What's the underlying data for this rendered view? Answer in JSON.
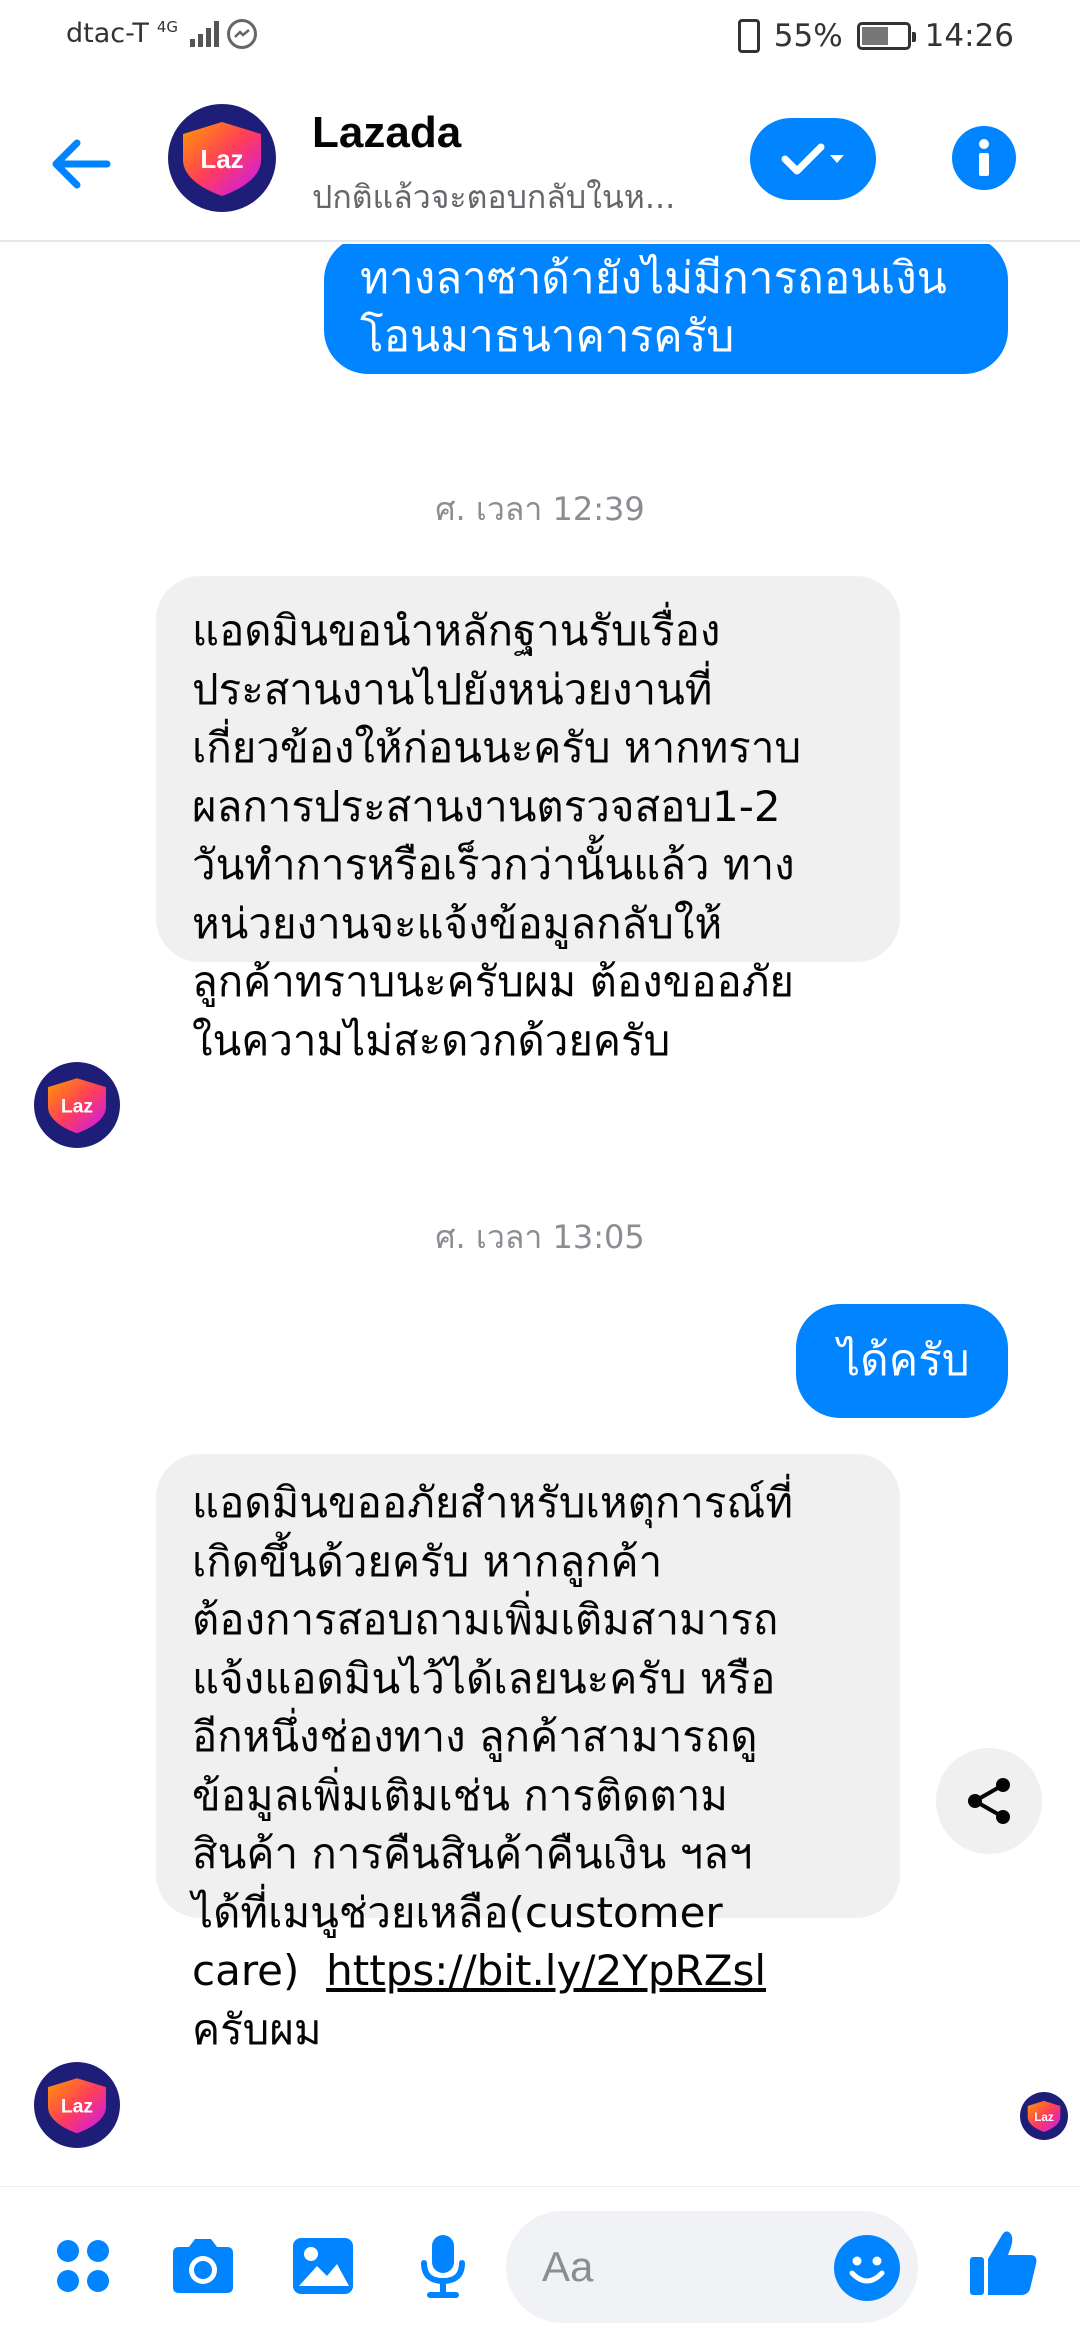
{
  "status": {
    "carrier": "dtac-T",
    "network": "4G",
    "battery": "55%",
    "time": "14:26"
  },
  "header": {
    "name": "Lazada",
    "subtitle": "ปกติแล้วจะตอบกลับในห...",
    "avatar_text": "Laz"
  },
  "messages": {
    "out1_line1": "ทางลาซาด้ายังไม่มีการถอนเงิน",
    "out1_line2": "โอนมาธนาคารครับ",
    "ts1": "ศ. เวลา 12:39",
    "in1_lines": [
      "แอดมินขอนำหลักฐานรับเรื่อง",
      "ประสานงานไปยังหน่วยงานที่",
      "เกี่ยวข้องให้ก่อนนะครับ หากทราบ",
      "ผลการประสานงานตรวจสอบ1-2",
      "วันทำการหรือเร็วกว่านั้นแล้ว ทาง",
      "หน่วยงานจะแจ้งข้อมูลกลับให้",
      "ลูกค้าทราบนะครับผม ต้องขออภัย",
      "ในความไม่สะดวกด้วยครับ"
    ],
    "ts2": "ศ. เวลา 13:05",
    "out2": "ได้ครับ",
    "in2_lines": [
      "แอดมินขออภัยสำหรับเหตุการณ์ที่",
      "เกิดขึ้นด้วยครับ หากลูกค้า",
      "ต้องการสอบถามเพิ่มเติมสามารถ",
      "แจ้งแอดมินไว้ได้เลยนะครับ หรือ",
      "อีกหนึ่งช่องทาง ลูกค้าสามารถดู",
      "ข้อมูลเพิ่มเติมเช่น การติดตาม",
      "สินค้า การคืนสินค้าคืนเงิน ฯลฯ",
      "ได้ที่เมนูช่วยเหลือ(customer"
    ],
    "in2_care": "care)",
    "in2_link": "https://bit.ly/2YpRZsl",
    "in2_last": "ครับผม"
  },
  "composer": {
    "placeholder": "Aa"
  },
  "icons": {
    "back": "back-arrow-icon",
    "check": "check-icon",
    "info": "info-icon",
    "share": "share-icon",
    "menu": "four-dots-icon",
    "camera": "camera-icon",
    "gallery": "image-icon",
    "mic": "microphone-icon",
    "emoji": "emoji-icon",
    "like": "thumbs-up-icon"
  },
  "colors": {
    "accent": "#0084ff",
    "incoming_bubble": "#f0f0f0",
    "brand_bg": "#1e1e78"
  }
}
